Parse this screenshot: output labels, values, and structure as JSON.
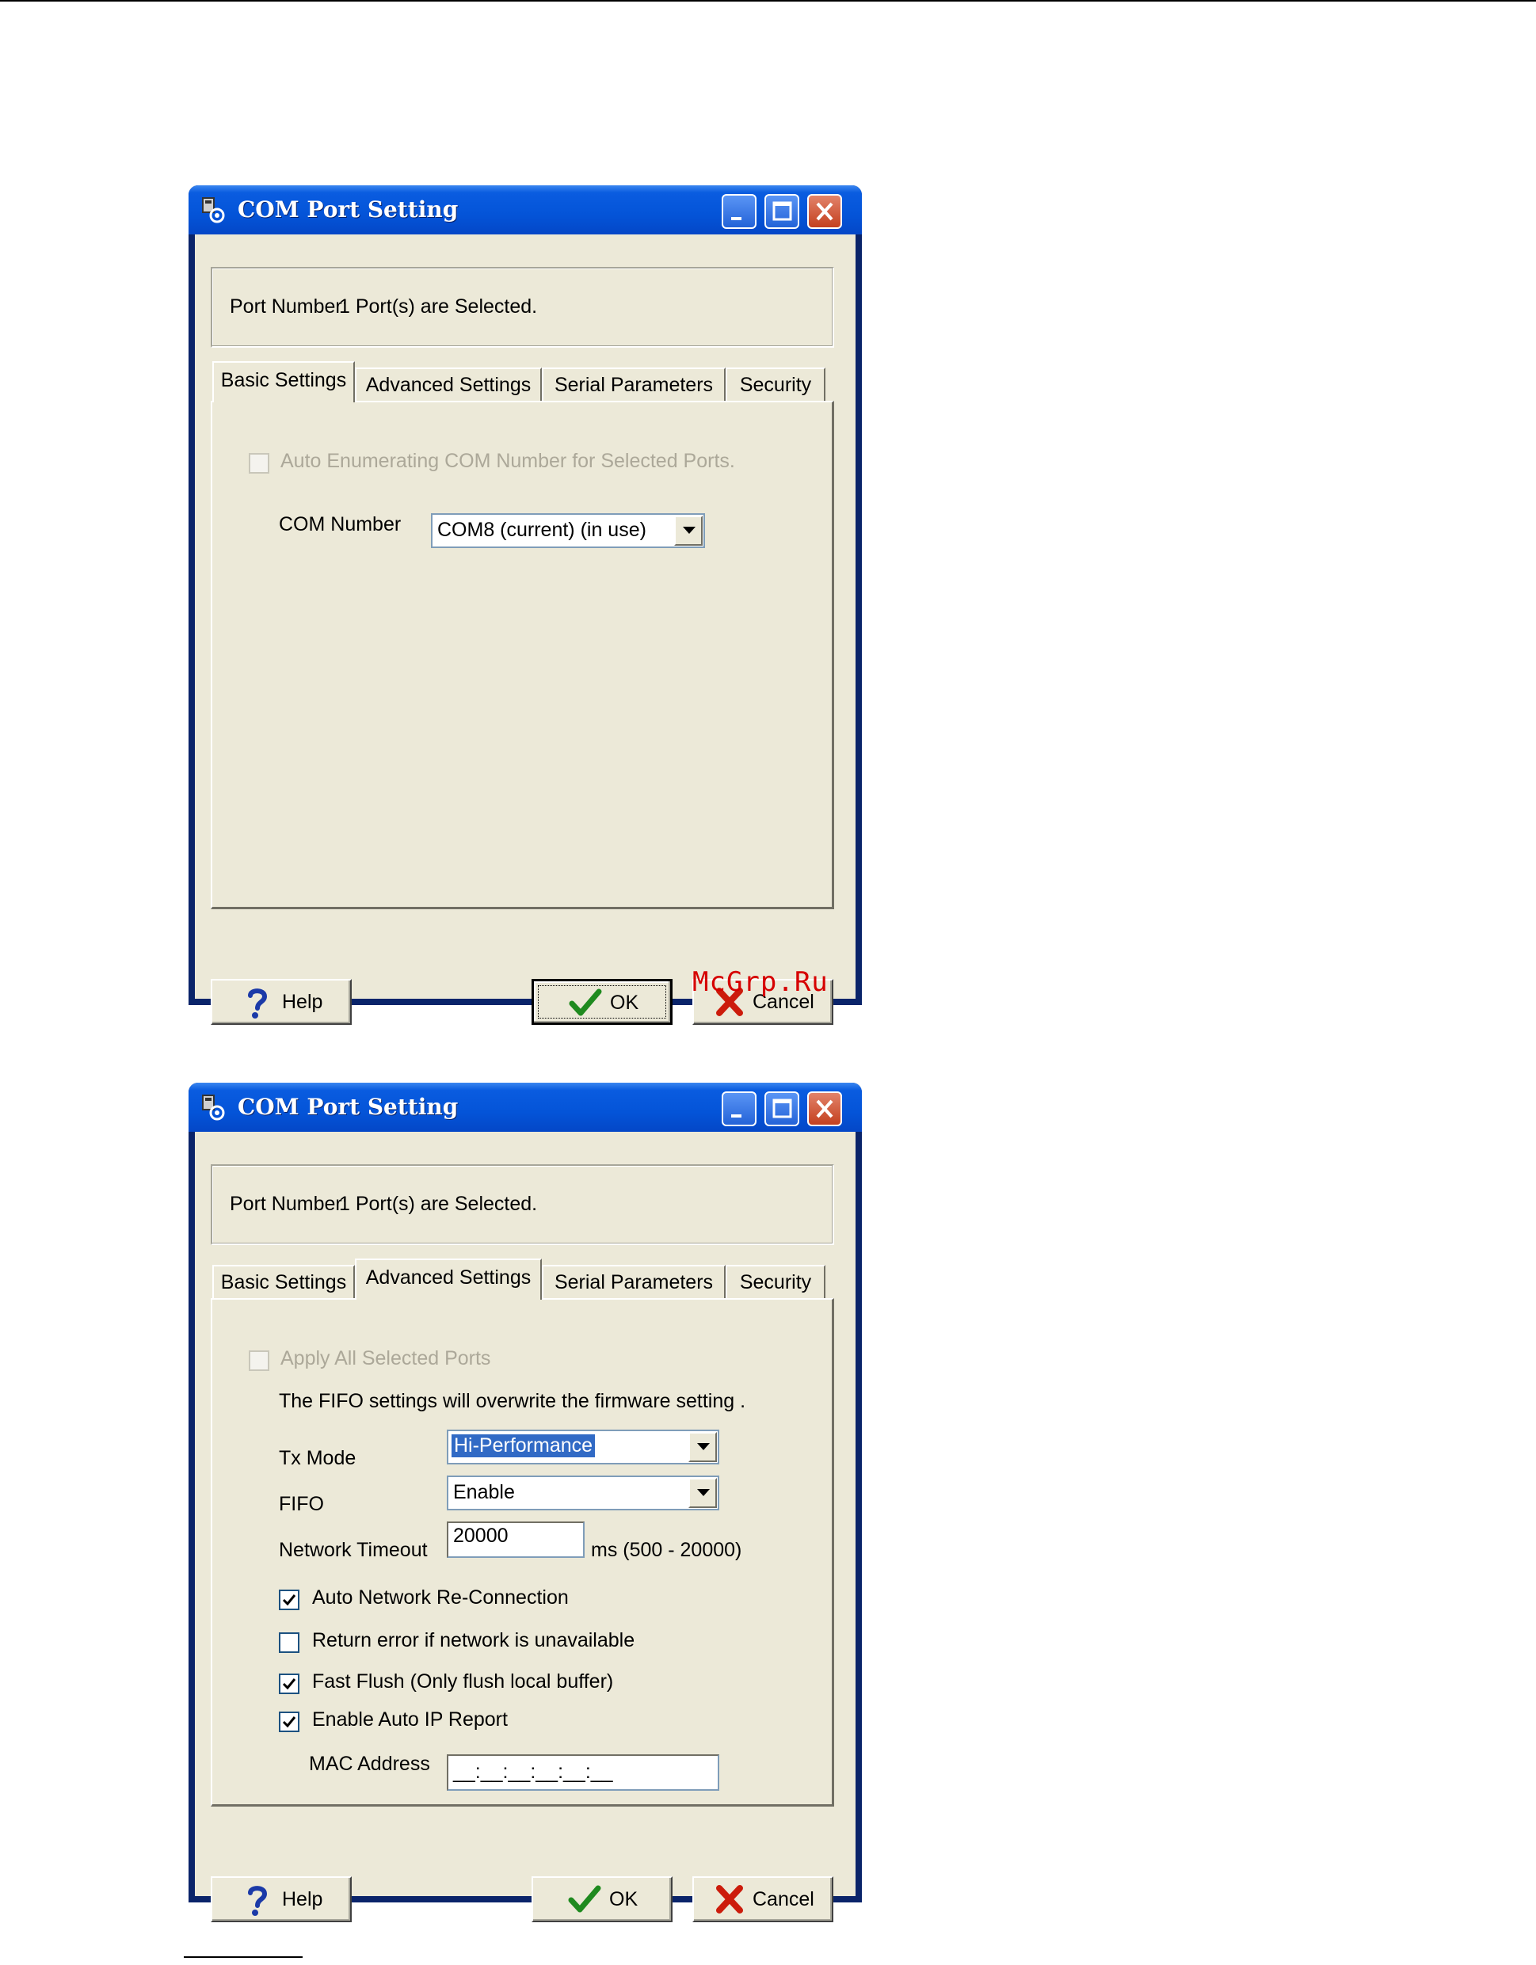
{
  "windows": [
    {
      "title": "COM Port Setting",
      "port_label": "Port Number:",
      "port_value": "1 Port(s) are Selected.",
      "tabs": [
        "Basic Settings",
        "Advanced Settings",
        "Serial Parameters",
        "Security"
      ],
      "active_tab": "Basic Settings",
      "basic": {
        "auto_enum_label": "Auto Enumerating COM Number for Selected Ports.",
        "auto_enum_checked": false,
        "auto_enum_enabled": false,
        "com_number_label": "COM Number",
        "com_number_value": "COM8 (current) (in use)"
      },
      "buttons": {
        "help": "Help",
        "ok": "OK",
        "cancel": "Cancel"
      }
    },
    {
      "title": "COM Port Setting",
      "port_label": "Port Number:",
      "port_value": "1 Port(s) are Selected.",
      "tabs": [
        "Basic Settings",
        "Advanced Settings",
        "Serial Parameters",
        "Security"
      ],
      "active_tab": "Advanced Settings",
      "advanced": {
        "apply_all_label": "Apply All Selected Ports",
        "apply_all_checked": false,
        "apply_all_enabled": false,
        "fifo_note": "The FIFO settings will overwrite the firmware setting .",
        "tx_mode_label": "Tx Mode",
        "tx_mode_value": "Hi-Performance",
        "fifo_label": "FIFO",
        "fifo_value": "Enable",
        "network_timeout_label": "Network Timeout",
        "network_timeout_value": "20000",
        "network_timeout_range": "ms (500 - 20000)",
        "options": [
          {
            "label": "Auto Network Re-Connection",
            "checked": true
          },
          {
            "label": "Return error if network is unavailable",
            "checked": false
          },
          {
            "label": "Fast Flush (Only flush local buffer)",
            "checked": true
          },
          {
            "label": "Enable Auto IP Report",
            "checked": true
          }
        ],
        "mac_address_label": "MAC Address",
        "mac_address_value": "__:__:__:__:__:__"
      },
      "buttons": {
        "help": "Help",
        "ok": "OK",
        "cancel": "Cancel"
      }
    }
  ],
  "watermark": "McGrp.Ru",
  "icons": {
    "app": "com-port-app-icon",
    "minimize": "minimize-icon",
    "maximize": "maximize-icon",
    "close": "close-icon",
    "help": "question-mark-icon",
    "ok": "checkmark-icon",
    "cancel": "red-x-icon"
  },
  "colors": {
    "titlebar": "#0454d8",
    "dialog_bg": "#ece9d8",
    "selection": "#316ac5",
    "watermark": "#d60000"
  }
}
